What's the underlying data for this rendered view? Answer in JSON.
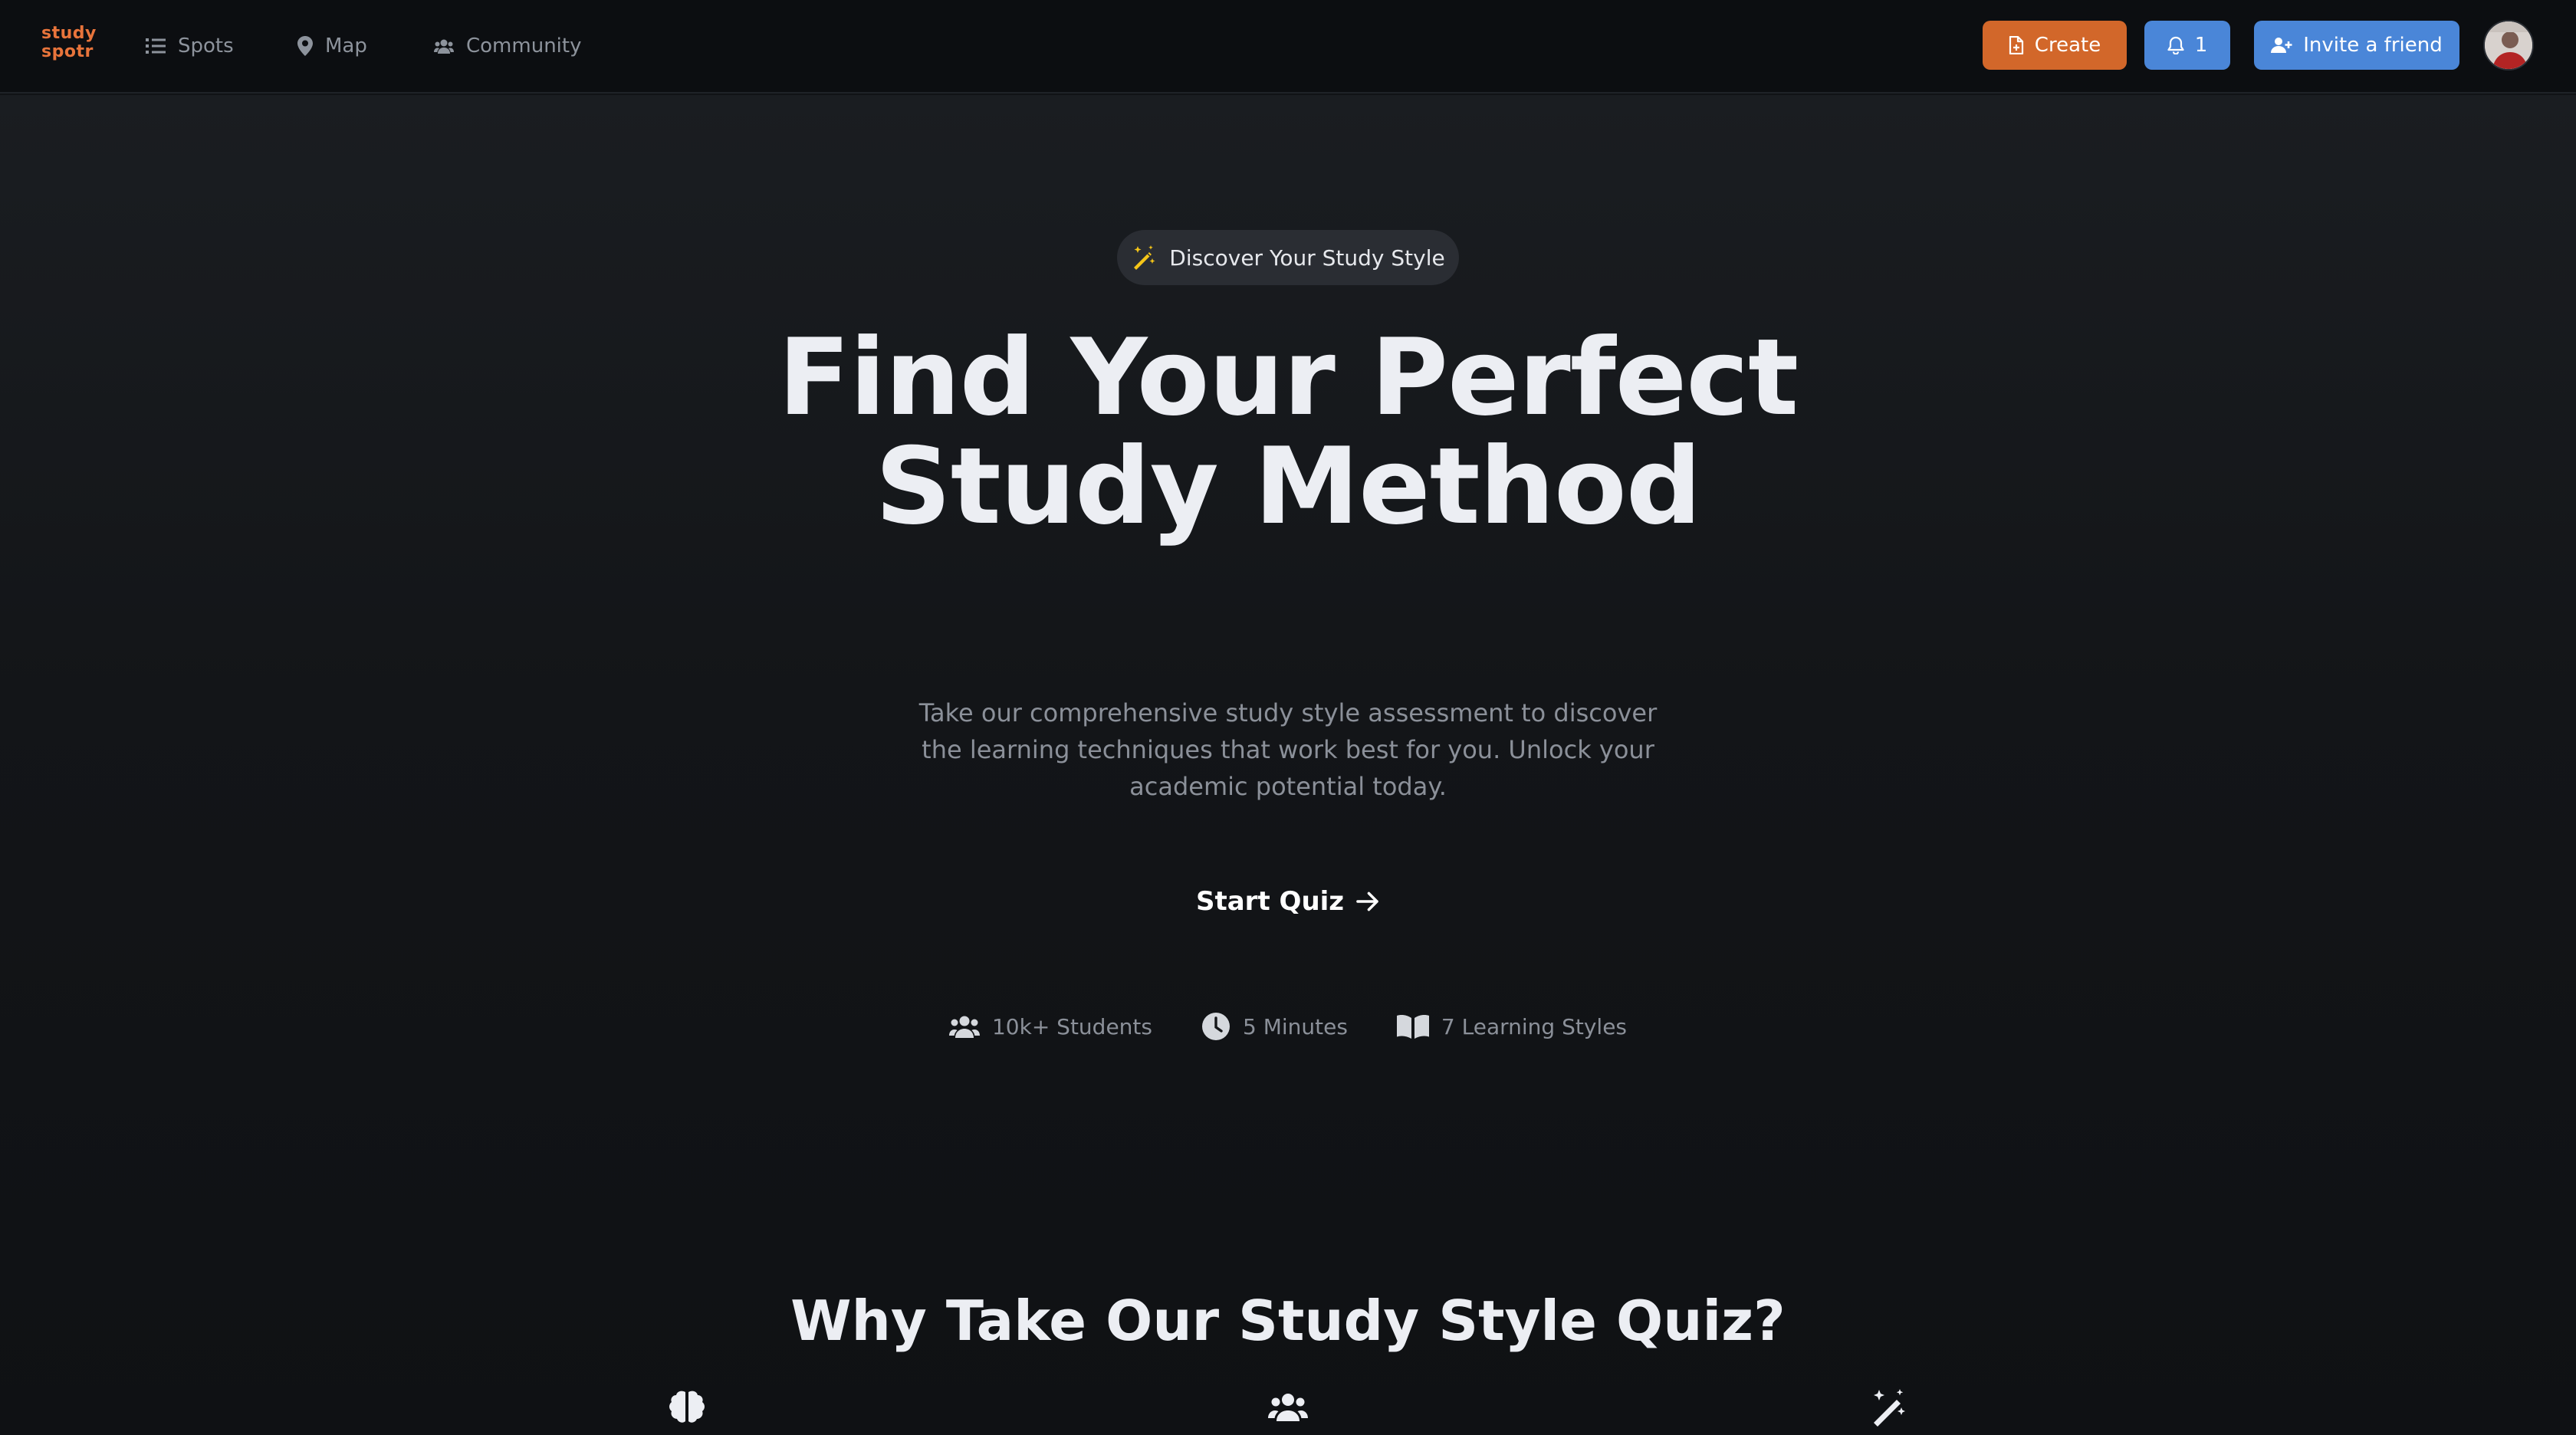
{
  "app": {
    "logo_line1": "study",
    "logo_line2": "spotr"
  },
  "nav": {
    "items": [
      {
        "label": "Spots",
        "icon": "list-icon"
      },
      {
        "label": "Map",
        "icon": "map-pin-icon"
      },
      {
        "label": "Community",
        "icon": "users-icon"
      }
    ]
  },
  "actions": {
    "create_label": "Create",
    "notifications_count": "1",
    "invite_label": "Invite a friend"
  },
  "hero": {
    "badge_label": "Discover Your Study Style",
    "title_line1": "Find Your Perfect",
    "title_line2": "Study Method",
    "description": "Take our comprehensive study style assessment to discover the learning techniques that work best for you. Unlock your academic potential today.",
    "cta_label": "Start Quiz"
  },
  "stats": [
    {
      "label": "10k+ Students",
      "icon": "users-icon"
    },
    {
      "label": "5 Minutes",
      "icon": "clock-icon"
    },
    {
      "label": "7 Learning Styles",
      "icon": "book-open-icon"
    }
  ],
  "why": {
    "title": "Why Take Our Study Style Quiz?",
    "feature_icons": [
      "brain-icon",
      "users-icon",
      "magic-wand-icon"
    ]
  },
  "colors": {
    "brand_orange": "#d2672a",
    "brand_blue": "#4a86d8",
    "background": "#111316",
    "accent_yellow": "#f5c518"
  }
}
